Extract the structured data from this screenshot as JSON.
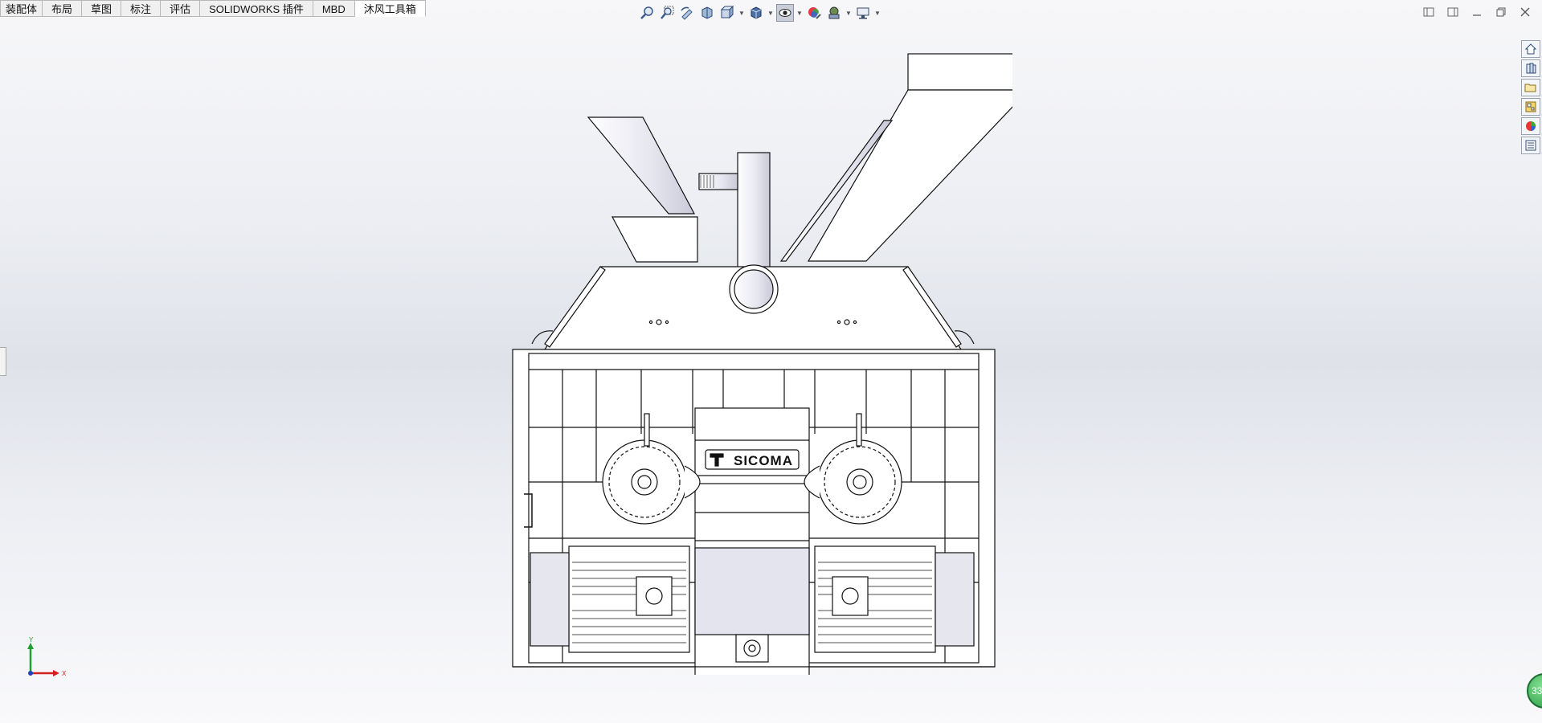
{
  "command_manager": {
    "tabs": [
      {
        "label": "装配体"
      },
      {
        "label": "布局"
      },
      {
        "label": "草图"
      },
      {
        "label": "标注"
      },
      {
        "label": "评估"
      },
      {
        "label": "SOLIDWORKS 插件"
      },
      {
        "label": "MBD"
      },
      {
        "label": "沐风工具箱",
        "active": true
      }
    ]
  },
  "heads_up_toolbar": {
    "icons": [
      "zoom-to-fit-icon",
      "zoom-to-area-icon",
      "previous-view-icon",
      "section-view-icon",
      "view-orientation-icon",
      "display-style-icon",
      "hide-show-items-icon",
      "edit-appearance-icon",
      "apply-scene-icon",
      "view-settings-icon"
    ]
  },
  "window_controls": [
    "tile-left-icon",
    "tile-right-icon",
    "minimize-icon",
    "restore-icon",
    "close-icon"
  ],
  "task_pane": [
    "solidworks-resources-icon",
    "design-library-icon",
    "file-explorer-icon",
    "view-palette-icon",
    "appearances-icon",
    "custom-properties-icon"
  ],
  "model": {
    "logo_text": "SICOMA"
  },
  "triad": {
    "x_label": "X",
    "y_label": "Y"
  },
  "badge": {
    "text": "33"
  },
  "colors": {
    "background_top": "#f7f7f9",
    "background_mid": "#dfe2e9",
    "model_line": "#111111",
    "model_fill": "#ffffff",
    "model_shade": "#e4e4ee",
    "triad_x": "#d42020",
    "triad_y": "#20a030"
  }
}
